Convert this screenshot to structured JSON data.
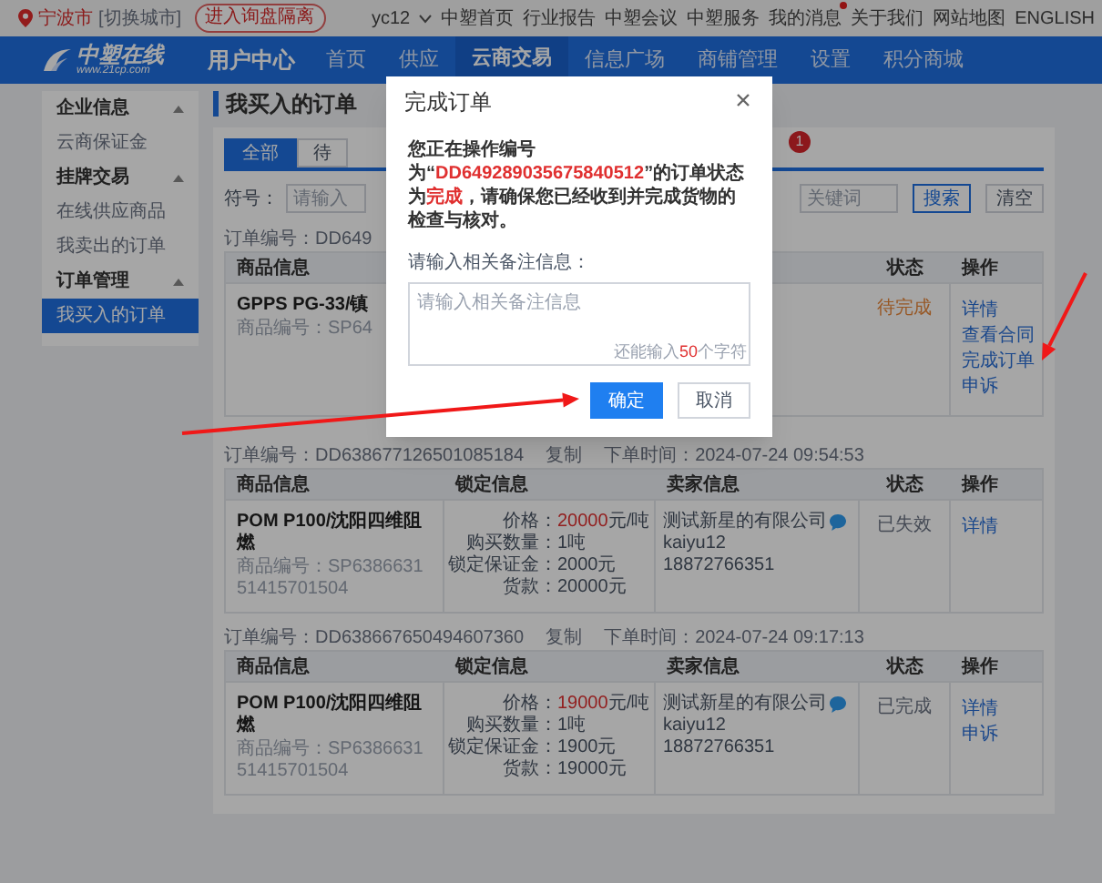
{
  "top_bar": {
    "city": "宁波市",
    "switch_city": "[切换城市]",
    "inquiry_button": "进入询盘隔离",
    "user": "yc12",
    "links": [
      {
        "label": "中塑首页",
        "badge": false
      },
      {
        "label": "行业报告",
        "badge": false
      },
      {
        "label": "中塑会议",
        "badge": false
      },
      {
        "label": "中塑服务",
        "badge": false
      },
      {
        "label": "我的消息",
        "badge": true
      },
      {
        "label": "关于我们",
        "badge": false
      },
      {
        "label": "网站地图",
        "badge": false
      },
      {
        "label": "ENGLISH",
        "badge": false
      }
    ]
  },
  "nav": {
    "logo_text": "中塑在线",
    "logo_url": "www.21cp.com",
    "section": "用户中心",
    "items": [
      {
        "label": "首页",
        "selected": false
      },
      {
        "label": "供应",
        "selected": false
      },
      {
        "label": "云商交易",
        "selected": true
      },
      {
        "label": "信息广场",
        "selected": false
      },
      {
        "label": "商铺管理",
        "selected": false
      },
      {
        "label": "设置",
        "selected": false
      },
      {
        "label": "积分商城",
        "selected": false
      }
    ]
  },
  "sidebar": {
    "groups": [
      {
        "label": "企业信息",
        "expanded": true,
        "items": [
          {
            "label": "云商保证金",
            "selected": false
          }
        ]
      },
      {
        "label": "挂牌交易",
        "expanded": true,
        "items": [
          {
            "label": "在线供应商品",
            "selected": false
          },
          {
            "label": "我卖出的订单",
            "selected": false
          }
        ]
      },
      {
        "label": "订单管理",
        "expanded": true,
        "items": [
          {
            "label": "我买入的订单",
            "selected": true
          }
        ]
      }
    ]
  },
  "page_title": "我买入的订单",
  "tabs": [
    {
      "label": "全部",
      "selected": true
    },
    {
      "label": "待",
      "selected": false
    }
  ],
  "tab_badge": "1",
  "search": {
    "label": "符号：",
    "fields": [
      {
        "placeholder": "请输入"
      },
      {
        "placeholder": "关键词"
      }
    ],
    "buttons": [
      {
        "label": "搜索",
        "kind": "primary"
      },
      {
        "label": "清空",
        "kind": "default"
      }
    ]
  },
  "orders": [
    {
      "number": "订单编号：DD649",
      "columns": [
        {
          "kind": "product",
          "label": "商品信息"
        },
        {
          "kind": "status",
          "label": "状态"
        },
        {
          "kind": "action",
          "label": "操作"
        }
      ],
      "product": {
        "name": "GPPS PG-33/镇",
        "code": "商品编号：SP64"
      },
      "status": {
        "text": "待完成",
        "pending": true
      },
      "actions": [
        "详情",
        "查看合同",
        "完成订单",
        "申诉"
      ]
    },
    {
      "number": "订单编号：DD638677126501085184",
      "copy": "复制",
      "time": "下单时间：2024-07-24 09:54:53",
      "columns": [
        {
          "kind": "product",
          "label": "商品信息"
        },
        {
          "kind": "lock",
          "label": "锁定信息"
        },
        {
          "kind": "seller",
          "label": "卖家信息"
        },
        {
          "kind": "status",
          "label": "状态"
        },
        {
          "kind": "action",
          "label": "操作"
        }
      ],
      "product": {
        "name": "POM P100/沈阳四维阻燃",
        "code": "商品编号：SP638663151415701504"
      },
      "lock": [
        {
          "kind": "price",
          "label": "价格：",
          "value": "20000",
          "suffix": "元/吨"
        },
        {
          "kind": "plain",
          "label": "购买数量：",
          "value": "1吨"
        },
        {
          "kind": "plain",
          "label": "锁定保证金：",
          "value": "2000元"
        },
        {
          "kind": "plain",
          "label": "货款：",
          "value": "20000元"
        }
      ],
      "seller": {
        "company": "测试新星的有限公司",
        "user": "kaiyu12",
        "phone": "18872766351"
      },
      "status": {
        "text": "已失效",
        "pending": false
      },
      "actions": [
        "详情"
      ]
    },
    {
      "number": "订单编号：DD638667650494607360",
      "copy": "复制",
      "time": "下单时间：2024-07-24 09:17:13",
      "columns": [
        {
          "kind": "product",
          "label": "商品信息"
        },
        {
          "kind": "lock",
          "label": "锁定信息"
        },
        {
          "kind": "seller",
          "label": "卖家信息"
        },
        {
          "kind": "status",
          "label": "状态"
        },
        {
          "kind": "action",
          "label": "操作"
        }
      ],
      "product": {
        "name": "POM P100/沈阳四维阻燃",
        "code": "商品编号：SP638663151415701504"
      },
      "lock": [
        {
          "kind": "price",
          "label": "价格：",
          "value": "19000",
          "suffix": "元/吨"
        },
        {
          "kind": "plain",
          "label": "购买数量：",
          "value": "1吨"
        },
        {
          "kind": "plain",
          "label": "锁定保证金：",
          "value": "1900元"
        },
        {
          "kind": "plain",
          "label": "货款：",
          "value": "19000元"
        }
      ],
      "seller": {
        "company": "测试新星的有限公司",
        "user": "kaiyu12",
        "phone": "18872766351"
      },
      "status": {
        "text": "已完成",
        "pending": false
      },
      "actions": [
        "详情",
        "申诉"
      ]
    }
  ],
  "modal": {
    "title": "完成订单",
    "message": [
      {
        "text": "您正在操作编号为“",
        "kind": "plain"
      },
      {
        "text": "DD649289035675840512",
        "kind": "order"
      },
      {
        "text": "”的订单状态为",
        "kind": "plain"
      },
      {
        "text": "完成",
        "kind": "state"
      },
      {
        "text": "，请确保您已经收到并完成货物的检查与核对。",
        "kind": "plain"
      }
    ],
    "note_label": "请输入相关备注信息：",
    "note_placeholder": "请输入相关备注信息",
    "counter": {
      "before": "还能输入",
      "count": "50",
      "after": "个字符"
    },
    "buttons": [
      {
        "label": "确定",
        "kind": "primary"
      },
      {
        "label": "取消",
        "kind": "default"
      }
    ]
  },
  "annotations": [
    {
      "kind": "arrow"
    },
    {
      "kind": "arrow"
    }
  ]
}
